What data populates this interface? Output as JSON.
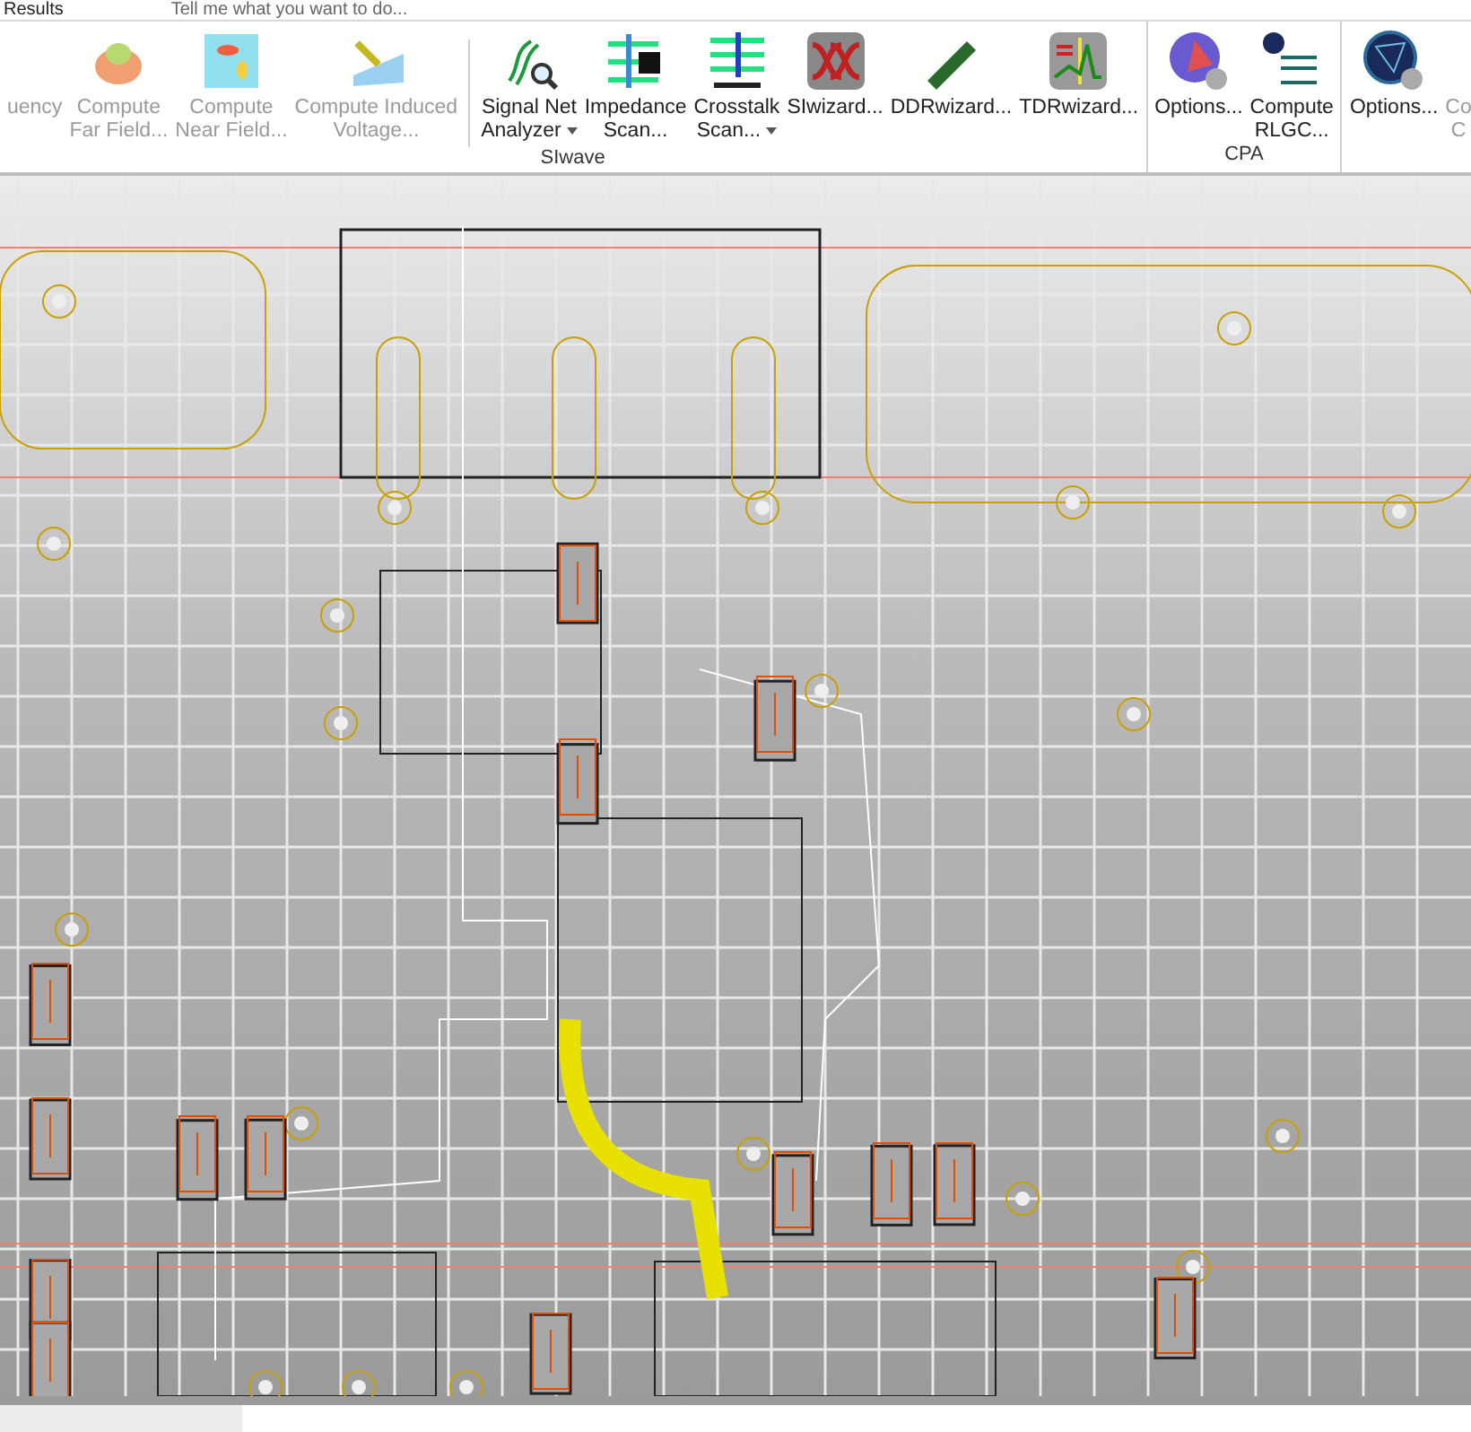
{
  "top_bar": {
    "tab": "Results",
    "search_placeholder": "Tell me what you want to do..."
  },
  "ribbon": {
    "groups": [
      {
        "label": "SIwave",
        "items": [
          {
            "kind": "cut",
            "lines": [
              "uency"
            ],
            "disabled": true,
            "dropdown": false
          },
          {
            "kind": "farfield",
            "lines": [
              "Compute",
              "Far Field..."
            ],
            "disabled": true,
            "dropdown": false
          },
          {
            "kind": "nearfield",
            "lines": [
              "Compute",
              "Near Field..."
            ],
            "disabled": true,
            "dropdown": false
          },
          {
            "kind": "induced",
            "lines": [
              "Compute Induced",
              "Voltage..."
            ],
            "disabled": true,
            "dropdown": false
          },
          {
            "kind": "separator"
          },
          {
            "kind": "netanalyzer",
            "lines": [
              "Signal Net",
              "Analyzer"
            ],
            "disabled": false,
            "dropdown": true
          },
          {
            "kind": "impedance",
            "lines": [
              "Impedance",
              "Scan..."
            ],
            "disabled": false,
            "dropdown": false
          },
          {
            "kind": "crosstalk",
            "lines": [
              "Crosstalk",
              "Scan..."
            ],
            "disabled": false,
            "dropdown": true
          },
          {
            "kind": "siwizard",
            "lines": [
              "SIwizard..."
            ],
            "disabled": false,
            "dropdown": false
          },
          {
            "kind": "ddr",
            "lines": [
              "DDRwizard..."
            ],
            "disabled": false,
            "dropdown": false
          },
          {
            "kind": "tdr",
            "lines": [
              "TDRwizard..."
            ],
            "disabled": false,
            "dropdown": false
          }
        ]
      },
      {
        "label": "CPA",
        "items": [
          {
            "kind": "sphere",
            "lines": [
              "Options..."
            ],
            "disabled": false,
            "dropdown": false
          },
          {
            "kind": "rlgc",
            "lines": [
              "Compute",
              "RLGC..."
            ],
            "disabled": false,
            "dropdown": false
          }
        ]
      },
      {
        "items": [
          {
            "kind": "globe",
            "lines": [
              "Options..."
            ],
            "disabled": false,
            "dropdown": false
          },
          {
            "kind": "cut",
            "lines": [
              "Co",
              "C"
            ],
            "disabled": true,
            "dropdown": false
          }
        ]
      }
    ]
  }
}
